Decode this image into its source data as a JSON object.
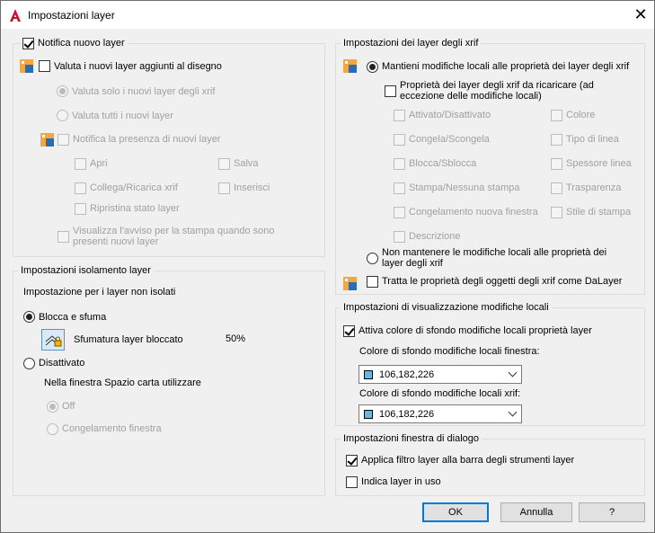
{
  "window": {
    "title": "Impostazioni layer",
    "close_glyph": "✕"
  },
  "colors": {
    "accent": "#0078d7",
    "swatch": "#6ab6e2"
  },
  "new_layer": {
    "legend": "Notifica nuovo layer",
    "evaluate": "Valuta i nuovi layer aggiunti al disegno",
    "only_xrif": "Valuta solo i nuovi layer degli xrif",
    "all_new": "Valuta tutti i nuovi layer",
    "notify_presence": "Notifica la presenza di nuovi layer",
    "open": "Apri",
    "save": "Salva",
    "attach": "Collega/Ricarica xrif",
    "insert": "Inserisci",
    "restore": "Ripristina stato layer",
    "plot_warning_1": "Visualizza l'avviso per la stampa quando sono",
    "plot_warning_2": "presenti nuovi layer"
  },
  "isolate": {
    "legend": "Impostazioni isolamento layer",
    "subtitle": "Impostazione per i layer non isolati",
    "lock_fade": "Blocca e sfuma",
    "fade_label": "Sfumatura layer bloccato",
    "fade_value": "50%",
    "off": "Disattivato",
    "paper_space": "Nella finestra Spazio carta utilizzare",
    "off_opt": "Off",
    "freeze_vp": "Congelamento finestra"
  },
  "xref": {
    "legend": "Impostazioni dei layer degli xrif",
    "keep_changes": "Mantieni modifiche locali alle proprietà dei layer degli xrif",
    "reload_1": "Proprietà dei layer degli xrif da ricaricare (ad",
    "reload_2": "eccezione delle modifiche locali)",
    "props": [
      "Attivato/Disattivato",
      "Colore",
      "Congela/Scongela",
      "Tipo di linea",
      "Blocca/Sblocca",
      "Spessore linea",
      "Stampa/Nessuna stampa",
      "Trasparenza",
      "Congelamento nuova finestra",
      "Stile di stampa",
      "Descrizione"
    ],
    "dont_keep_1": "Non mantenere le modifiche locali alle proprietà dei",
    "dont_keep_2": "layer degli xrif",
    "bylayer": "Tratta le proprietà degli oggetti degli xrif come DaLayer"
  },
  "override": {
    "legend": "Impostazioni di visualizzazione modifiche locali",
    "enable": "Attiva colore di sfondo modifiche locali proprietà layer",
    "vp_label": "Colore di sfondo modifiche locali finestra:",
    "vp_value": "106,182,226",
    "xref_label": "Colore di sfondo modifiche locali xrif:",
    "xref_value": "106,182,226"
  },
  "dialog": {
    "legend": "Impostazioni finestra di dialogo",
    "apply_filter": "Applica filtro layer alla barra degli strumenti layer",
    "indicate_in_use": "Indica layer in uso"
  },
  "buttons": {
    "ok": "OK",
    "cancel": "Annulla",
    "help": "?"
  }
}
